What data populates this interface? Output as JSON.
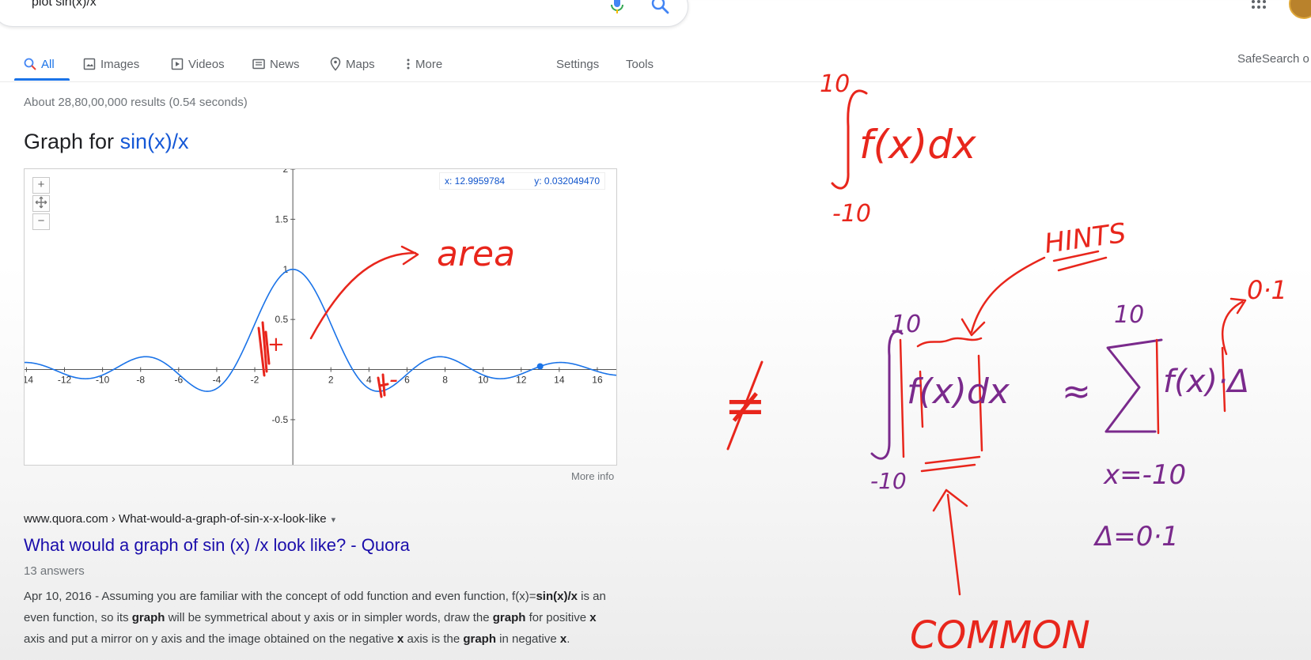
{
  "search": {
    "query": "plot sin(x)/x"
  },
  "tabs": [
    {
      "label": "All",
      "icon": "search-icon"
    },
    {
      "label": "Images",
      "icon": "image-icon"
    },
    {
      "label": "Videos",
      "icon": "play-icon"
    },
    {
      "label": "News",
      "icon": "news-icon"
    },
    {
      "label": "Maps",
      "icon": "map-pin-icon"
    },
    {
      "label": "More",
      "icon": "more-vert-icon"
    }
  ],
  "tools": {
    "settings": "Settings",
    "tools": "Tools",
    "safesearch": "SafeSearch o"
  },
  "stats": "About 28,80,00,000 results (0.54 seconds)",
  "graph": {
    "title_prefix": "Graph for ",
    "title_fn": "sin(x)/x",
    "zoom_in": "+",
    "zoom_out": "−",
    "coord_x": "x: 12.9959784",
    "coord_y": "y: 0.032049470",
    "more_info": "More info"
  },
  "chart_data": {
    "type": "line",
    "title": "",
    "xlabel": "",
    "ylabel": "",
    "function": "sin(x)/x",
    "xlim": [
      -14.1,
      17
    ],
    "ylim": [
      -0.95,
      2
    ],
    "x_ticks": [
      -14,
      -12,
      -10,
      -8,
      -6,
      -4,
      -2,
      2,
      4,
      6,
      8,
      10,
      12,
      14,
      16
    ],
    "y_ticks": [
      -0.5,
      0.5,
      1,
      1.5
    ],
    "y_tick_labels": [
      "-0.5",
      "0.5",
      "1",
      "1.5",
      "2"
    ],
    "highlight_point": {
      "x": 12.9959784,
      "y": 0.03204947
    },
    "grid": false,
    "series": [
      {
        "color": "#1a73e8"
      }
    ]
  },
  "result": {
    "cite": "www.quora.com › What-would-a-graph-of-sin-x-x-look-like",
    "cite_arrow": "▾",
    "title": "What would a graph of sin (x) /x look like? - Quora",
    "answers": "13 answers",
    "date": "Apr 10, 2016",
    "snippet_html": " - Assuming you are familiar with the concept of odd function and even function, f(x)=<b>sin(x)/x</b> is an even function, so its <b>graph</b> will be symmetrical about y axis or in simpler words, draw the <b>graph</b> for positive <b>x</b> axis and put a mirror on y axis and the image obtained on the negative <b>x</b> axis is the <b>graph</b> in negative <b>x</b>."
  },
  "annotations": {
    "area": "area",
    "hints": "HINTS",
    "common": "COMMON",
    "int_upper": "10",
    "int_lower": "-10",
    "int_body": "f(x)dx",
    "sum_upper": "10",
    "sum_lower": "x=-10",
    "delta_def": "Δ=0·1",
    "delta_val": "0·1",
    "approx_lhs": "f(x)dx",
    "approx_rhs": "f(x)·Δ",
    "not_equal": "≠",
    "plus": "+",
    "minus": "-",
    "red": "#e8261c",
    "purple": "#7a2a8c"
  }
}
